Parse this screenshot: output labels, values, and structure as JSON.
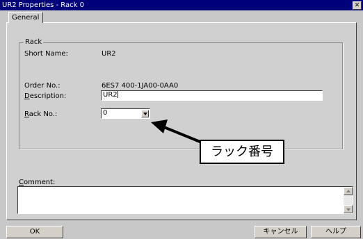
{
  "window": {
    "title": "UR2 Properties - Rack 0",
    "close_glyph": "✕"
  },
  "tabs": [
    {
      "label": "General"
    }
  ],
  "rack_group": {
    "label": "Rack",
    "short_name_label": "Short Name:",
    "short_name_value": "UR2",
    "order_no_label": "Order No.:",
    "order_no_value": "6ES7 400-1JA00-0AA0",
    "description_label_first": "D",
    "description_label_rest": "escription:",
    "description_value": "UR2",
    "rack_no_label_first": "R",
    "rack_no_label_rest": "ack No.:",
    "rack_no_value": "0"
  },
  "annotation": {
    "callout_text": "ラック番号"
  },
  "comment": {
    "label_first": "C",
    "label_rest": "omment:",
    "value": ""
  },
  "buttons": {
    "ok": "OK",
    "cancel": "キャンセル",
    "help": "ヘルプ"
  },
  "icons": {
    "close": "close-icon",
    "dropdown": "chevron-down-icon",
    "scroll_up": "scroll-up-icon",
    "scroll_down": "scroll-down-icon",
    "arrow": "arrow-icon"
  }
}
